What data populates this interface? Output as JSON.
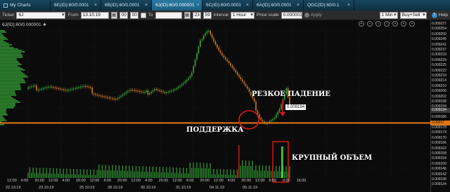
{
  "tabs": [
    {
      "label": "My Charts",
      "active": false
    },
    {
      "label": "6E(ID):60/0.0001",
      "active": false
    },
    {
      "label": "6B(ID):60/0.0001",
      "active": false
    },
    {
      "label": "6J(ID):60/0.000001",
      "active": true
    },
    {
      "label": "6C(ID):60/0.0001",
      "active": false
    },
    {
      "label": "6A(ID):60/0.0001",
      "active": false
    },
    {
      "label": "QGC(ID):60/0.1",
      "active": false
    }
  ],
  "toolbar": {
    "ticker_label": "Ticker",
    "ticker_value": "6J",
    "from_label": "From",
    "from_date": "13.10.19",
    "from_hour": "00",
    "from_min": "00",
    "to_label": "To",
    "to_hour": "23",
    "to_min": "59",
    "interval_label": "Interval",
    "interval_value": "1 Hour",
    "price_scale_label": "Price scale",
    "price_scale_value": "0.000001",
    "apply_label": "Apply",
    "period_value": "1 Min",
    "mode_value": "Buy+Sell",
    "help_label": "Help"
  },
  "chart": {
    "title": "6J(ID):60/0.000001",
    "price_ticks": [
      "0.009227",
      "0.009254",
      "0.009250",
      "0.009245",
      "0.009241",
      "0.009237",
      "0.009233",
      "0.009229",
      "0.009225",
      "0.009222",
      "0.009218",
      "0.009214",
      "0.009210",
      "0.009206",
      "0.009202",
      "0.009198",
      "0.009194",
      "0.009190",
      "0.009186",
      "0.009182",
      "0.009178",
      "0.009174",
      "0.009170",
      "0.009166",
      "0.009162",
      "0.009158",
      "0.009154",
      "0.009150",
      "0.009146",
      "0.009142",
      "0.009138",
      "0.009134"
    ],
    "current_price": "0.009194",
    "support_price": "0.00917",
    "time_ticks": [
      "12:00",
      "4:00",
      "20:00",
      "12:00",
      "4:00",
      "20:00",
      "12:00",
      "4:00",
      "20:00",
      "12:00",
      "4:00",
      "20:00",
      "12:00",
      "4:00",
      "20:00",
      "12:00",
      "4:00",
      "20:00",
      "12:00",
      "8:00",
      "0:00",
      "16:00"
    ],
    "date_ticks": [
      "22.10.19",
      "23.10.19",
      "25.10.19",
      "28.10.19",
      "30.10.19",
      "31.10.19",
      "04.11.19",
      "05.11.19"
    ],
    "annotations": {
      "sharp_drop": "РЕЗКОЕ ПАДЕНИЕ",
      "support": "ПОДДЕРЖКА",
      "big_volume": "КРУПНЫЙ ОБЪЕМ"
    },
    "colors": {
      "support_line": "#e07818",
      "highlight": "#e01818",
      "candle_up": "#3aa63a",
      "candle_down": "#c8782a",
      "volume": "#2e8b2e",
      "profile": "#37a637"
    }
  }
}
